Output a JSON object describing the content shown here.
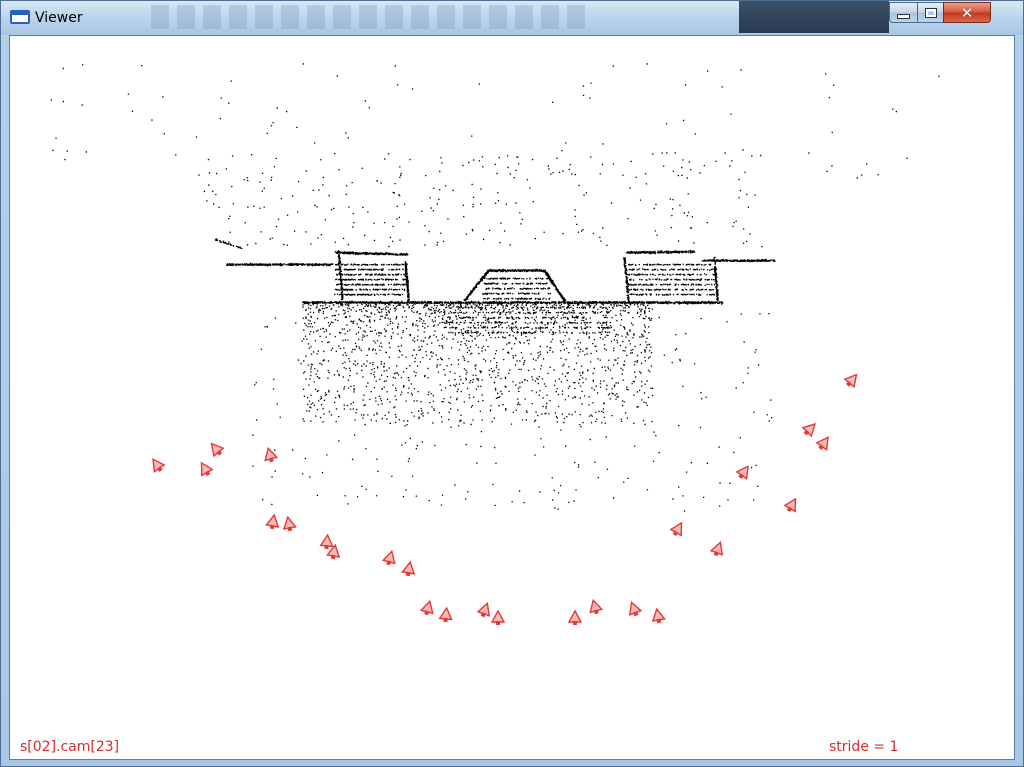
{
  "window": {
    "title": "Viewer",
    "close_glyph": "✕"
  },
  "icons": {
    "app": "window-app-icon",
    "minimize": "minimize-icon",
    "maximize": "maximize-icon",
    "close": "close-icon"
  },
  "viewer": {
    "camera_label": "s[02].cam[23]",
    "stride_label": "stride = 1",
    "colors": {
      "background": "#ffffff",
      "points": "#000000",
      "camera": "#e53935",
      "label": "#d32f2f"
    }
  }
}
